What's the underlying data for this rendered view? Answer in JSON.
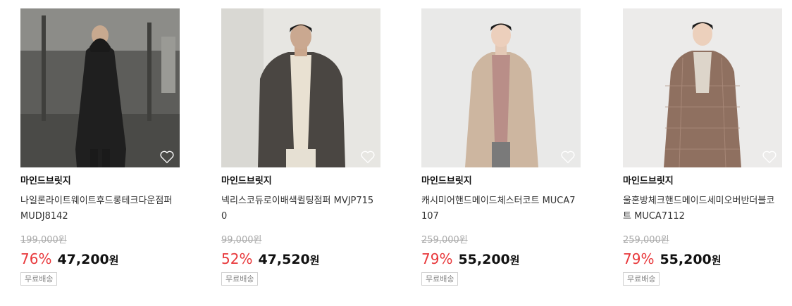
{
  "products": [
    {
      "brand": "마인드브릿지",
      "name": "나일론라이트웨이트후드롱테크다운점퍼 MUDJ8142",
      "original_price": "199,000원",
      "discount_rate": "76%",
      "sale_price": "47,200",
      "currency": "원",
      "badge": "무료배송"
    },
    {
      "brand": "마인드브릿지",
      "name": "넥리스코듀로이배색퀼팅점퍼 MVJP7150",
      "original_price": "99,000원",
      "discount_rate": "52%",
      "sale_price": "47,520",
      "currency": "원",
      "badge": "무료배송"
    },
    {
      "brand": "마인드브릿지",
      "name": "캐시미어핸드메이드체스터코트 MUCA7107",
      "original_price": "259,000원",
      "discount_rate": "79%",
      "sale_price": "55,200",
      "currency": "원",
      "badge": "무료배송"
    },
    {
      "brand": "마인드브릿지",
      "name": "울혼방체크핸드메이드세미오버반더블코트 MUCA7112",
      "original_price": "259,000원",
      "discount_rate": "79%",
      "sale_price": "55,200",
      "currency": "원",
      "badge": "무료배송"
    }
  ],
  "icons": {
    "wishlist": "heart-outline-icon"
  },
  "colors": {
    "discount": "#e8383b",
    "original_price": "#aaaaaa"
  }
}
